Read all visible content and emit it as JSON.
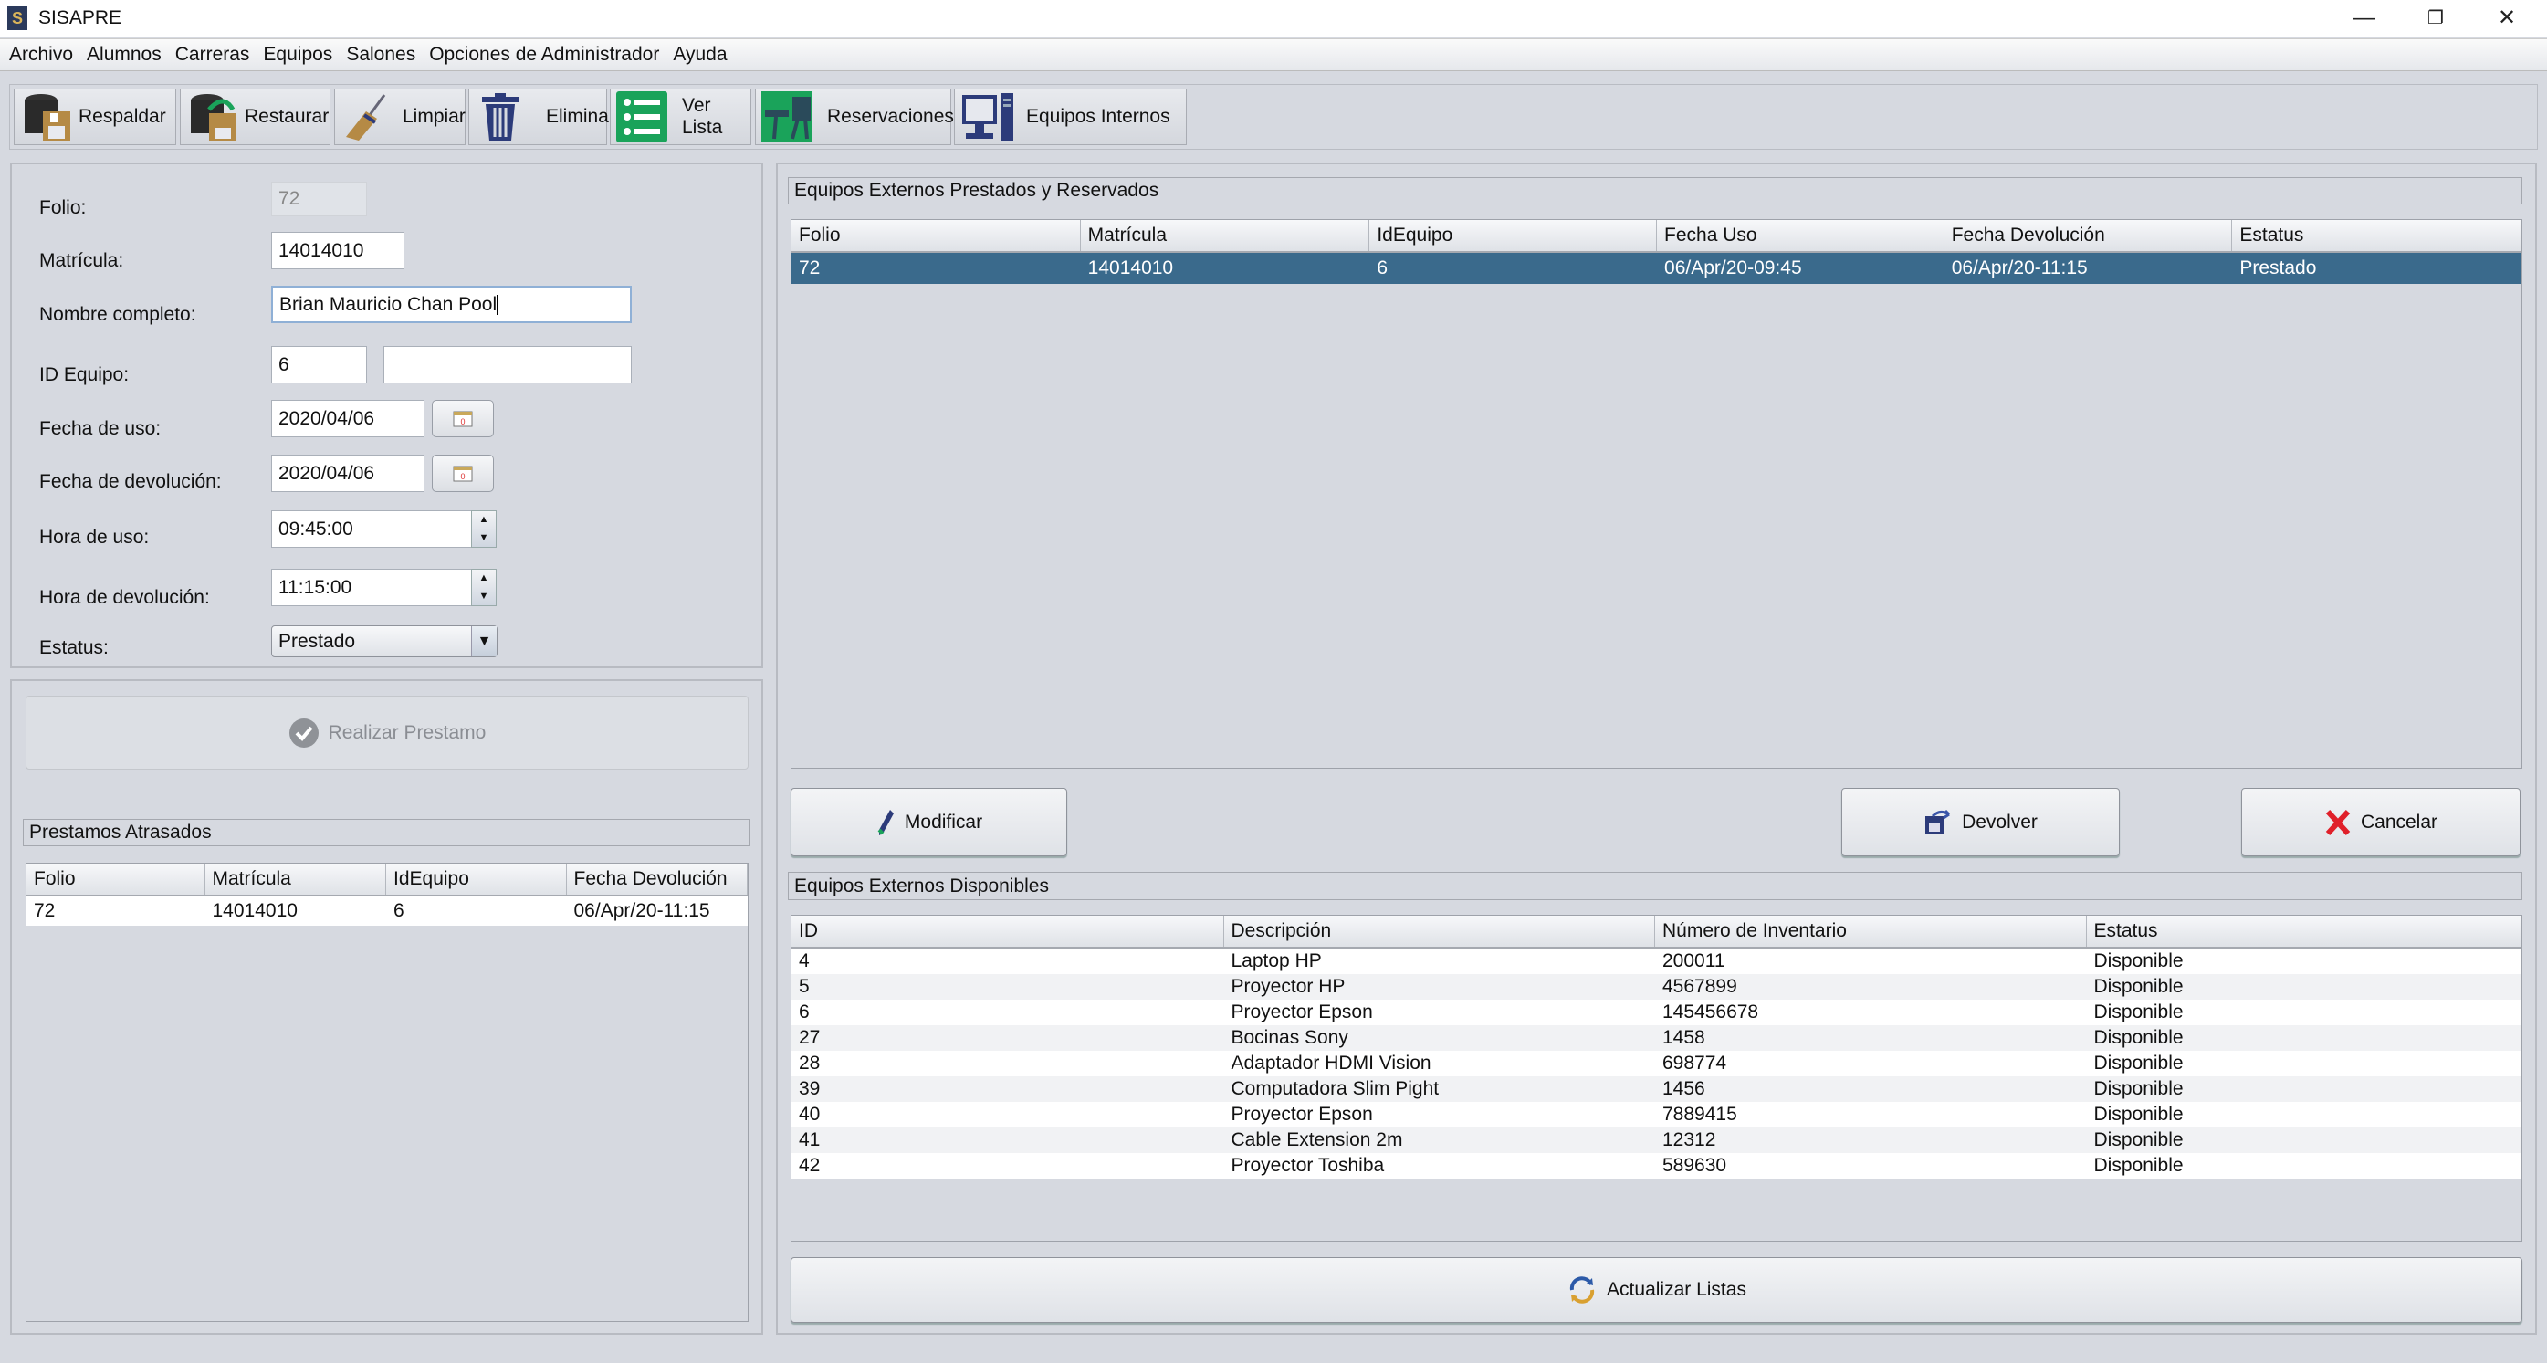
{
  "window": {
    "title": "SISAPRE",
    "controls": {
      "minimize": "—",
      "restore": "❐",
      "close": "✕"
    }
  },
  "menu": [
    "Archivo",
    "Alumnos",
    "Carreras",
    "Equipos",
    "Salones",
    "Opciones de Administrador",
    "Ayuda"
  ],
  "toolbar": [
    {
      "label": "Respaldar",
      "icon": "database-backup-icon"
    },
    {
      "label": "Restaurar",
      "icon": "database-restore-icon"
    },
    {
      "label": "Limpiar",
      "icon": "broom-icon"
    },
    {
      "label": "Eliminar",
      "icon": "trash-icon"
    },
    {
      "label": "Ver Lista",
      "icon": "list-icon"
    },
    {
      "label": "Reservaciones",
      "icon": "desk-chair-icon"
    },
    {
      "label": "Equipos Internos",
      "icon": "desktop-computer-icon"
    }
  ],
  "form": {
    "folio": {
      "label": "Folio:",
      "value": "72"
    },
    "matricula": {
      "label": "Matrícula:",
      "value": "14014010"
    },
    "nombre": {
      "label": "Nombre completo:",
      "value": "Brian Mauricio Chan Pool"
    },
    "id_equipo": {
      "label": "ID Equipo:",
      "value": "6",
      "description": ""
    },
    "fecha_uso": {
      "label": "Fecha de uso:",
      "value": "2020/04/06"
    },
    "fecha_devolucion": {
      "label": "Fecha de devolución:",
      "value": "2020/04/06"
    },
    "hora_uso": {
      "label": "Hora de uso:",
      "value": "09:45:00"
    },
    "hora_devolucion": {
      "label": "Hora de devolución:",
      "value": "11:15:00"
    },
    "estatus": {
      "label": "Estatus:",
      "value": "Prestado"
    }
  },
  "realizar_button": "Realizar Prestamo",
  "atrasados": {
    "title": "Prestamos Atrasados",
    "columns": [
      "Folio",
      "Matrícula",
      "IdEquipo",
      "Fecha Devolución"
    ],
    "rows": [
      [
        "72",
        "14014010",
        "6",
        "06/Apr/20-11:15"
      ]
    ]
  },
  "prestados": {
    "title": "Equipos Externos Prestados y Reservados",
    "columns": [
      "Folio",
      "Matrícula",
      "IdEquipo",
      "Fecha Uso",
      "Fecha Devolución",
      "Estatus"
    ],
    "rows": [
      [
        "72",
        "14014010",
        "6",
        "06/Apr/20-09:45",
        "06/Apr/20-11:15",
        "Prestado"
      ]
    ],
    "selected_row": 0
  },
  "actions": {
    "modificar": "Modificar",
    "devolver": "Devolver",
    "cancelar": "Cancelar"
  },
  "disponibles": {
    "title": "Equipos Externos Disponibles",
    "columns": [
      "ID",
      "Descripción",
      "Número de Inventario",
      "Estatus"
    ],
    "rows": [
      [
        "4",
        "Laptop HP",
        "200011",
        "Disponible"
      ],
      [
        "5",
        "Proyector HP",
        "4567899",
        "Disponible"
      ],
      [
        "6",
        "Proyector Epson",
        "145456678",
        "Disponible"
      ],
      [
        "27",
        "Bocinas Sony",
        "1458",
        "Disponible"
      ],
      [
        "28",
        "Adaptador HDMI Vision",
        "698774",
        "Disponible"
      ],
      [
        "39",
        "Computadora Slim Pight",
        "1456",
        "Disponible"
      ],
      [
        "40",
        "Proyector Epson",
        "7889415",
        "Disponible"
      ],
      [
        "41",
        "Cable Extension 2m",
        "12312",
        "Disponible"
      ],
      [
        "42",
        "Proyector Toshiba",
        "589630",
        "Disponible"
      ]
    ]
  },
  "actualizar_button": "Actualizar Listas",
  "colors": {
    "selection": "#3a6a8c",
    "background": "#d6d9e0",
    "accent_green": "#1aa35a",
    "accent_navy": "#2c3b7a"
  }
}
